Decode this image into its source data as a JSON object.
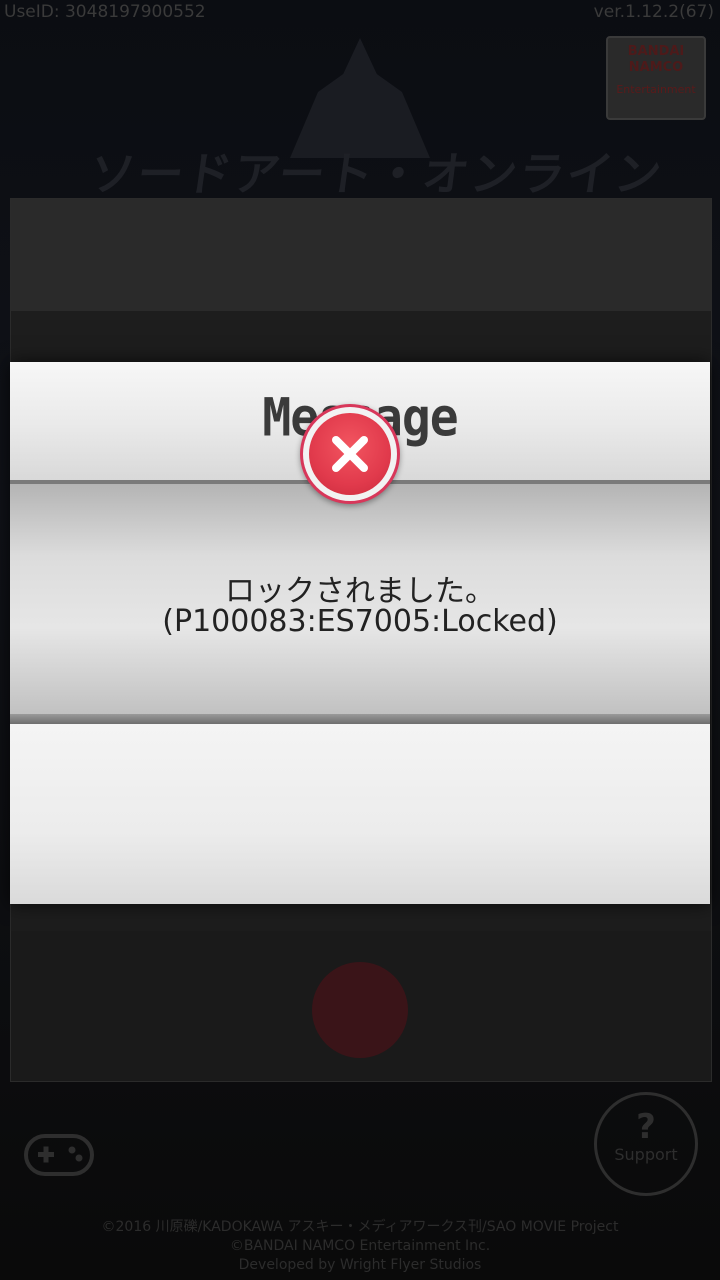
{
  "status_bar": {
    "user_id": "UseID: 3048197900552",
    "version": "ver.1.12.2(67)"
  },
  "background": {
    "game_title": "ソードアート・オンライン",
    "publisher_logo": "BANDAI NAMCO",
    "publisher_sub": "Entertainment",
    "support_label": "Support",
    "copyright_lines": [
      "©2016 川原礫/KADOKAWA アスキー・メディアワークス刊/SAO MOVIE Project",
      "©BANDAI NAMCO Entertainment Inc.",
      "Developed by Wright Flyer Studios"
    ]
  },
  "dialog": {
    "title": "Message",
    "message_line1": "ロックされました。",
    "message_line2": "(P100083:ES7005:Locked)",
    "close_icon": "close-x-icon",
    "accent_color": "#e13a4c"
  }
}
